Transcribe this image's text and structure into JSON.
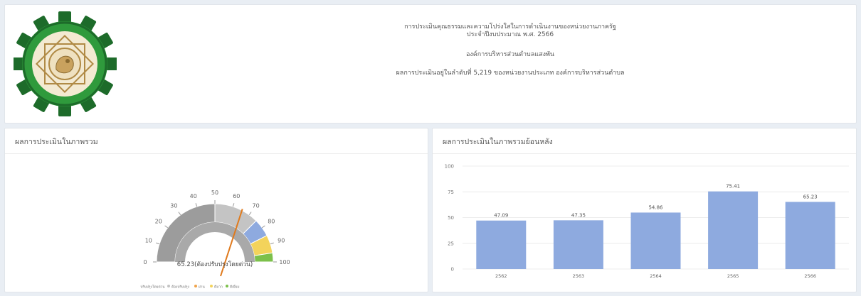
{
  "header": {
    "line1": "การประเมินคุณธรรมและความโปร่งใสในการดำเนินงานของหน่วยงานภาครัฐ",
    "line2": "ประจำปีงบประมาณ พ.ศ. 2566",
    "org_name": "องค์การบริหารส่วนตำบลแสงพัน",
    "rank_text": "ผลการประเมินอยู่ในลำดับที่ 5,219 ของหน่วยงานประเภท องค์การบริหารส่วนตำบล"
  },
  "overall": {
    "title": "ผลการประเมินในภาพรวม",
    "score_label": "65.23(ต้องปรับปรุงโดยด่วน)",
    "score": 65.23,
    "ticks": [
      "0",
      "10",
      "20",
      "30",
      "40",
      "50",
      "60",
      "70",
      "80",
      "90",
      "100"
    ],
    "bands": [
      {
        "from": 0,
        "to": 50,
        "color": "#9c9c9c"
      },
      {
        "from": 50,
        "to": 75,
        "color": "#c4c4c4"
      },
      {
        "from": 75,
        "to": 85,
        "color": "#8eaadf"
      },
      {
        "from": 85,
        "to": 95,
        "color": "#f3d35b"
      },
      {
        "from": 95,
        "to": 100,
        "color": "#7cc04b"
      }
    ],
    "needle_color": "#e07a1d",
    "legend": [
      {
        "label": "ต้องปรับปรุงโดยด่วน",
        "color": "#9c9c9c"
      },
      {
        "label": "ต้องปรับปรุง",
        "color": "#c4c4c4"
      },
      {
        "label": "ผ่าน",
        "color": "#f0a34a"
      },
      {
        "label": "ดีมาก",
        "color": "#f3d35b"
      },
      {
        "label": "ดีเยี่ยม",
        "color": "#7cc04b"
      }
    ]
  },
  "history": {
    "title": "ผลการประเมินในภาพรวมย้อนหลัง",
    "chart_data": {
      "type": "bar",
      "categories": [
        "2562",
        "2563",
        "2564",
        "2565",
        "2566"
      ],
      "values": [
        47.09,
        47.35,
        54.86,
        75.41,
        65.23
      ],
      "value_labels": [
        "47.09",
        "47.35",
        "54.86",
        "75.41",
        "65.23"
      ],
      "ylim": [
        0,
        100
      ],
      "yticks": [
        "0",
        "25",
        "50",
        "75",
        "100"
      ],
      "grid": true,
      "bar_color": "#8eaadf"
    }
  }
}
